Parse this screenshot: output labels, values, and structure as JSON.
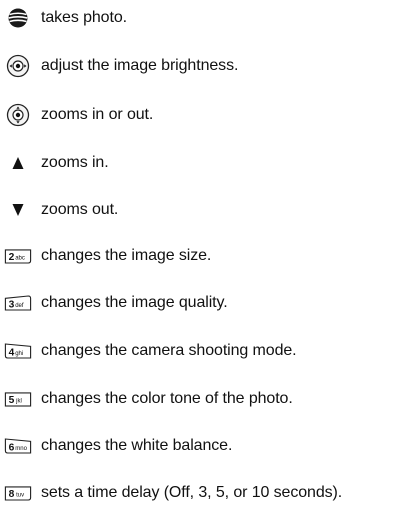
{
  "items": [
    {
      "icon": "att-globe-key-icon",
      "text": "takes photo."
    },
    {
      "icon": "nav-key-left-right-icon",
      "text": "adjust the image brightness."
    },
    {
      "icon": "nav-key-up-down-icon",
      "text": "zooms in or out."
    },
    {
      "icon": "up-arrow-icon",
      "text": "zooms in."
    },
    {
      "icon": "down-arrow-icon",
      "text": "zooms out."
    },
    {
      "icon": "key-2-abc-icon",
      "text": "changes the image size.",
      "key": {
        "digit": "2",
        "letters": "abc"
      }
    },
    {
      "icon": "key-3-def-icon",
      "text": "changes the image quality.",
      "key": {
        "digit": "3",
        "letters": "def"
      }
    },
    {
      "icon": "key-4-ghi-icon",
      "text": "changes the camera shooting mode.",
      "key": {
        "digit": "4",
        "letters": "ghi"
      }
    },
    {
      "icon": "key-5-jkl-icon",
      "text": "changes the color tone of the photo.",
      "key": {
        "digit": "5",
        "letters": "jkl"
      }
    },
    {
      "icon": "key-6-mno-icon",
      "text": "changes the white balance.",
      "key": {
        "digit": "6",
        "letters": "mno"
      }
    },
    {
      "icon": "key-8-tuv-icon",
      "text": "sets a time delay (Off, 3, 5, or 10 seconds).",
      "key": {
        "digit": "8",
        "letters": "tuv"
      }
    }
  ]
}
